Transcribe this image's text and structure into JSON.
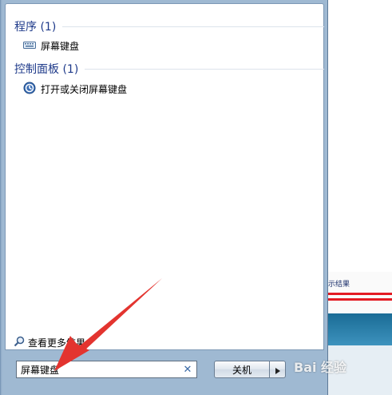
{
  "groups": [
    {
      "title": "程序 (1)",
      "items": [
        {
          "label": "屏幕键盘",
          "icon": "keyboard-icon"
        }
      ]
    },
    {
      "title": "控制面板 (1)",
      "items": [
        {
          "label": "打开或关闭屏幕键盘",
          "icon": "ease-of-access-icon"
        }
      ]
    }
  ],
  "see_more": {
    "label": "查看更多结果",
    "icon": "search-icon"
  },
  "search": {
    "value": "屏幕键盘",
    "clear_icon": "close-icon"
  },
  "shutdown": {
    "label": "关机",
    "arrow_icon": "chevron-right-icon"
  },
  "background_window": {
    "text": "示结果"
  },
  "watermark": {
    "text": "Bai 经验"
  },
  "colors": {
    "accent": "#1e3a8a",
    "arrow": "#e3342f",
    "frame": "#9fb9d2"
  }
}
